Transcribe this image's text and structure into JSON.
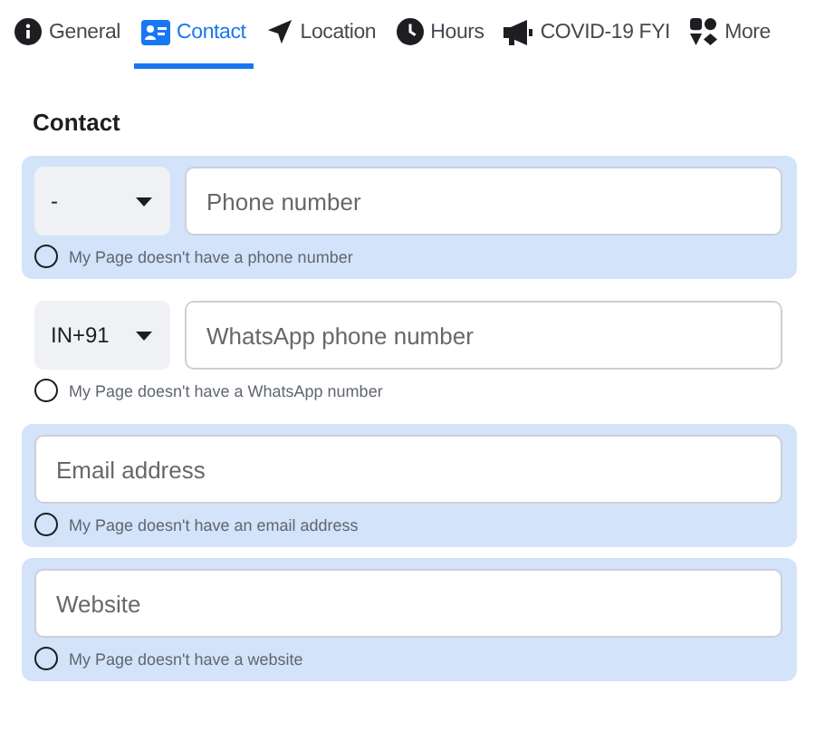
{
  "tabs": [
    {
      "label": "General",
      "kind": "info",
      "selected": false
    },
    {
      "label": "Contact",
      "kind": "contact",
      "selected": true
    },
    {
      "label": "Location",
      "kind": "arrow",
      "selected": false
    },
    {
      "label": "Hours",
      "kind": "clock",
      "selected": false
    },
    {
      "label": "COVID-19 FYI",
      "kind": "megaphone",
      "selected": false
    },
    {
      "label": "More",
      "kind": "shapes",
      "selected": false
    }
  ],
  "section_title": "Contact",
  "groups": [
    {
      "kind": "phone",
      "code": "-",
      "placeholder": "Phone number",
      "option": "My Page doesn't have a phone number",
      "checked": false,
      "highlighted": true
    },
    {
      "kind": "phone",
      "code": "IN+91",
      "placeholder": "WhatsApp phone number",
      "option": "My Page doesn't have a WhatsApp number",
      "checked": false,
      "highlighted": false
    },
    {
      "kind": "text",
      "placeholder": "Email address",
      "option": "My Page doesn't have an email address",
      "checked": false,
      "highlighted": true
    },
    {
      "kind": "text",
      "placeholder": "Website",
      "option": "My Page doesn't have a website",
      "checked": false,
      "highlighted": true
    }
  ]
}
